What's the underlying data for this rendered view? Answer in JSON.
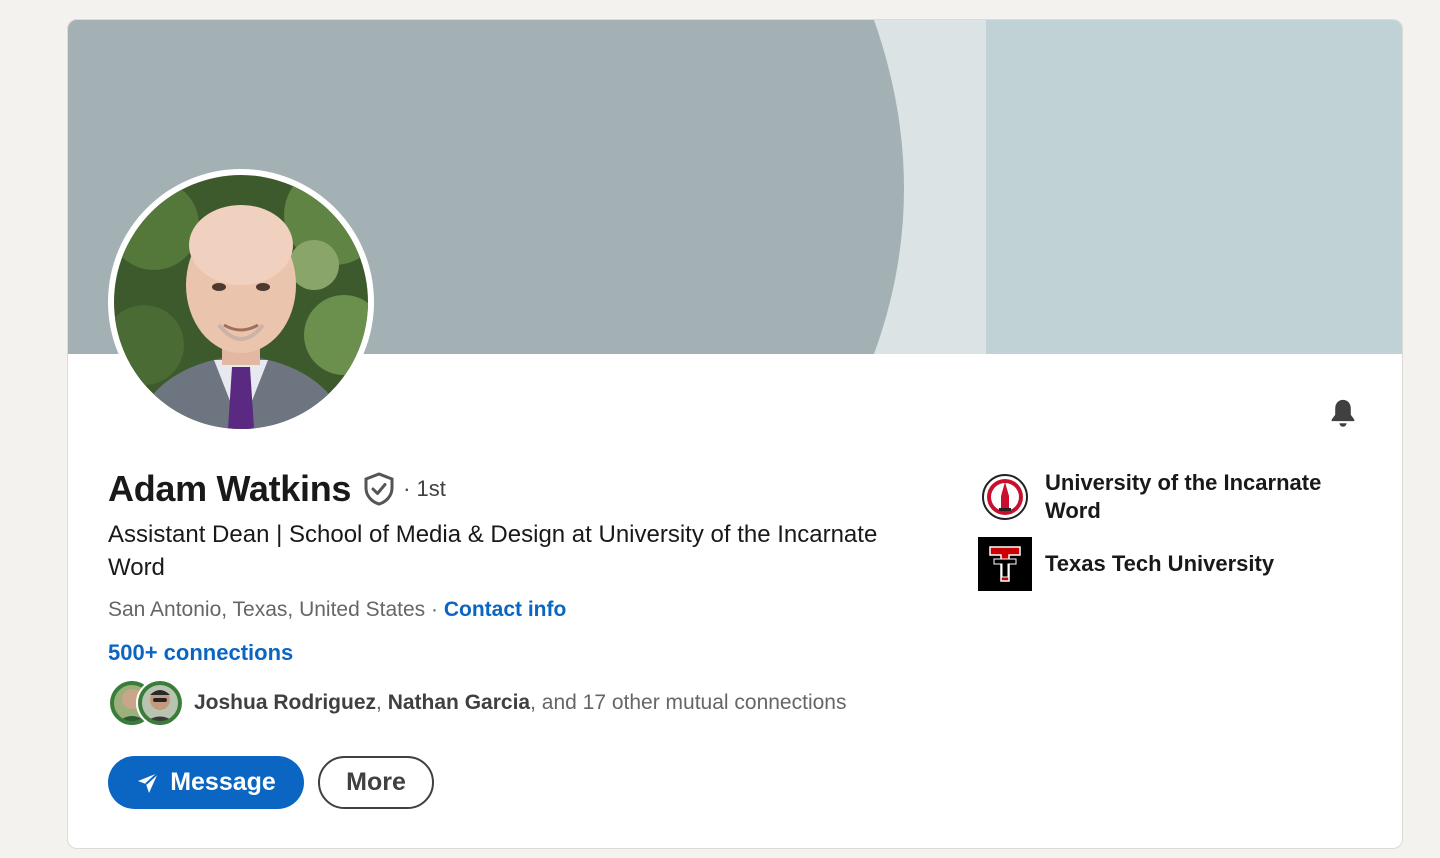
{
  "profile": {
    "name": "Adam Watkins",
    "degree": "· 1st",
    "headline": "Assistant Dean | School of Media & Design at University of the Incarnate Word",
    "location": "San Antonio, Texas, United States",
    "location_sep": " · ",
    "contact_info": "Contact info",
    "connections": "500+ connections"
  },
  "mutual": {
    "name1": "Joshua Rodriguez",
    "sep1": ", ",
    "name2": "Nathan Garcia",
    "rest": ", and 17 other mutual connections"
  },
  "actions": {
    "message_label": "Message",
    "more_label": "More"
  },
  "education": [
    {
      "name": "University of the Incarnate Word"
    },
    {
      "name": "Texas Tech University"
    }
  ],
  "colors": {
    "accent": "#0a66c2",
    "banner": "#a3b1b4",
    "banner_light": "#dbe3e5",
    "banner_right": "#c1d2d6"
  },
  "icons": {
    "verified": "shield-check-icon",
    "notify": "bell-icon",
    "message": "paper-plane-icon"
  }
}
